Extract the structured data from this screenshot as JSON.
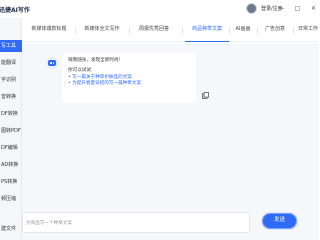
{
  "app": {
    "title": "迅捷AI写作"
  },
  "user": {
    "login_text": "登录/注册"
  },
  "window": {
    "minimize": "—",
    "maximize": "□",
    "close": "✕"
  },
  "sidebar": {
    "items": [
      {
        "label": "写工具",
        "active": true
      },
      {
        "label": "能翻译",
        "active": false
      },
      {
        "label": "字识别",
        "active": false
      },
      {
        "label": "音转换",
        "active": false
      },
      {
        "label": "DF转换",
        "active": false
      },
      {
        "label": "图转PDF",
        "active": false
      },
      {
        "label": "DF编辑",
        "active": false
      },
      {
        "label": "AD转换",
        "active": false
      },
      {
        "label": "PS转换",
        "active": false
      },
      {
        "label": "频压缩",
        "active": false
      },
      {
        "label": "建文件",
        "active": false
      }
    ]
  },
  "tabs": [
    {
      "label": "新媒体爆款标题",
      "active": false
    },
    {
      "label": "新媒体全文写作",
      "active": false
    },
    {
      "label": "周报优秀回答",
      "active": false
    },
    {
      "label": "商品种草文案",
      "active": true
    },
    {
      "label": "AI画画",
      "active": false
    },
    {
      "label": "广告创意",
      "active": false
    },
    {
      "label": "日常工作",
      "active": false
    }
  ],
  "chat": {
    "greeting": "嗨我随身，发现全新时尚!",
    "ask": "你可以试试:",
    "suggestions": [
      "• 写一篇关于种草护肤品的文案",
      "• 为提升春夏穿搭的写一篇种草文案"
    ]
  },
  "input": {
    "placeholder": "为商品写一个种草文案"
  },
  "send": {
    "label": "发送"
  },
  "colors": {
    "accent": "#2f6bf5",
    "background": "#f6f7fa"
  }
}
